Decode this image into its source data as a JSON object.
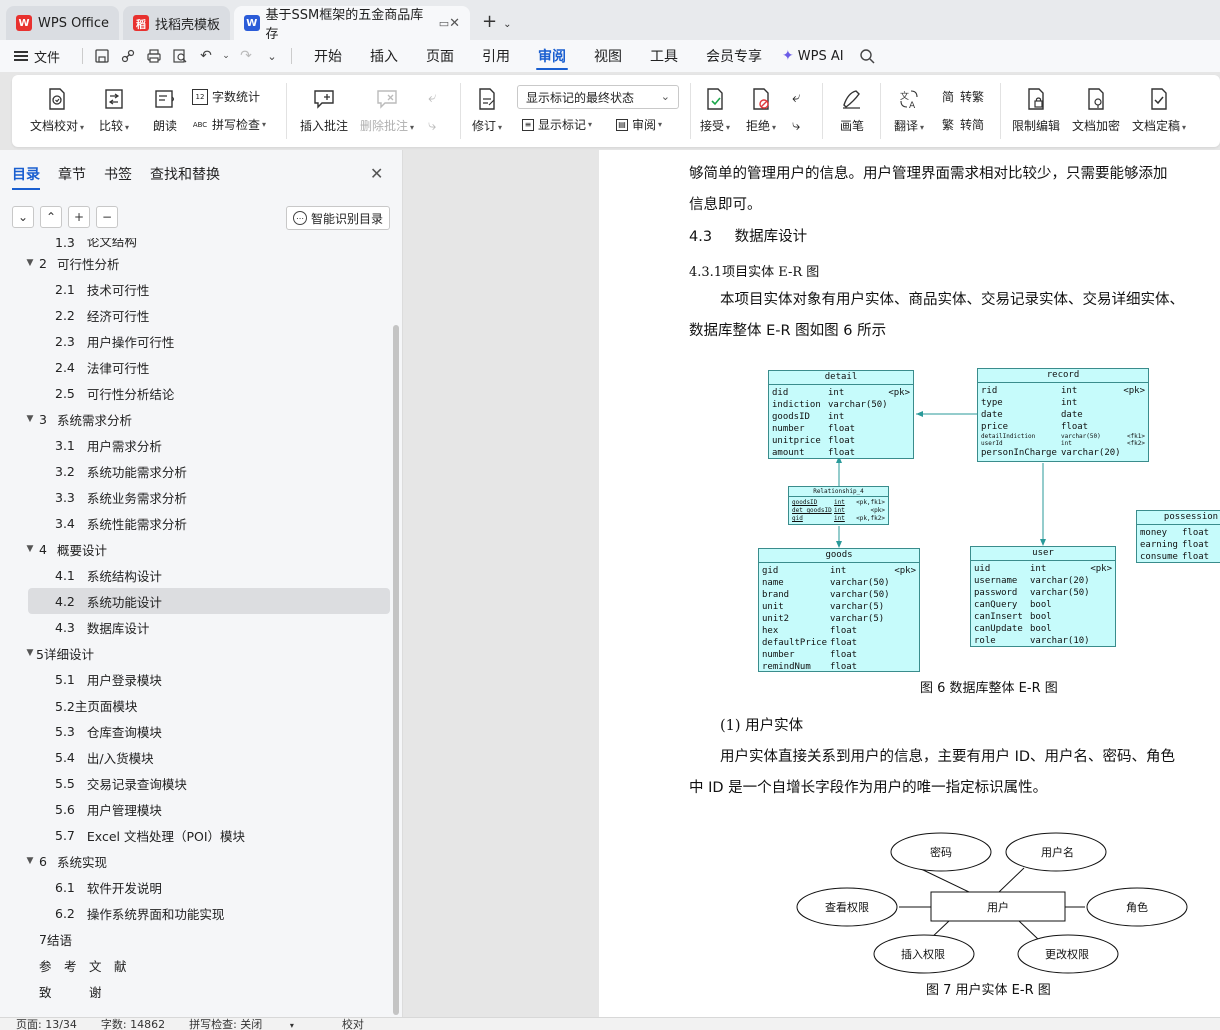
{
  "tabs": [
    {
      "label": "WPS Office",
      "logo": "W",
      "color": "#e8312f"
    },
    {
      "label": "找稻壳模板",
      "logo": "稻",
      "color": "#e8312f"
    },
    {
      "label": "基于SSM框架的五金商品库存",
      "logo": "W",
      "color": "#2b5cd8"
    }
  ],
  "menu": {
    "file": "文件",
    "items": [
      "开始",
      "插入",
      "页面",
      "引用",
      "审阅",
      "视图",
      "工具",
      "会员专享"
    ],
    "ai": "WPS AI"
  },
  "ribbon": {
    "doc_check": "文档校对",
    "compare": "比较",
    "read": "朗读",
    "word_count": "字数统计",
    "spell_check": "拼写检查",
    "insert_comment": "插入批注",
    "delete_comment": "删除批注",
    "track": "修订",
    "show_state": "显示标记的最终状态",
    "show_marks": "显示标记",
    "review": "审阅",
    "accept": "接受",
    "reject": "拒绝",
    "pen": "画笔",
    "translate": "翻译",
    "to_trad": "转繁",
    "to_simp": "转简",
    "restrict": "限制编辑",
    "encrypt": "文档加密",
    "finalize": "文档定稿"
  },
  "nav": {
    "tabs": [
      "目录",
      "章节",
      "书签",
      "查找和替换"
    ],
    "smart_btn": "智能识别目录",
    "toc": [
      {
        "level": 2,
        "num": "1.3",
        "text": "论文结构",
        "partial": true
      },
      {
        "level": 1,
        "num": "2",
        "text": "可行性分析"
      },
      {
        "level": 2,
        "num": "2.1",
        "text": "技术可行性"
      },
      {
        "level": 2,
        "num": "2.2",
        "text": "经济可行性"
      },
      {
        "level": 2,
        "num": "2.3",
        "text": "用户操作可行性"
      },
      {
        "level": 2,
        "num": "2.4",
        "text": "法律可行性"
      },
      {
        "level": 2,
        "num": "2.5",
        "text": "可行性分析结论"
      },
      {
        "level": 1,
        "num": "3",
        "text": "系统需求分析"
      },
      {
        "level": 2,
        "num": "3.1",
        "text": "用户需求分析"
      },
      {
        "level": 2,
        "num": "3.2",
        "text": "系统功能需求分析"
      },
      {
        "level": 2,
        "num": "3.3",
        "text": "系统业务需求分析"
      },
      {
        "level": 2,
        "num": "3.4",
        "text": "系统性能需求分析"
      },
      {
        "level": 1,
        "num": "4",
        "text": "概要设计"
      },
      {
        "level": 2,
        "num": "4.1",
        "text": "系统结构设计"
      },
      {
        "level": 2,
        "num": "4.2",
        "text": "系统功能设计",
        "selected": true
      },
      {
        "level": 2,
        "num": "4.3",
        "text": "数据库设计"
      },
      {
        "level": 1,
        "num": "",
        "text": "5详细设计"
      },
      {
        "level": 2,
        "num": "5.1",
        "text": "用户登录模块"
      },
      {
        "level": 2,
        "num": "",
        "text": "5.2主页面模块"
      },
      {
        "level": 2,
        "num": "5.3",
        "text": "仓库查询模块"
      },
      {
        "level": 2,
        "num": "5.4",
        "text": "出/入货模块"
      },
      {
        "level": 2,
        "num": "5.5",
        "text": "交易记录查询模块"
      },
      {
        "level": 2,
        "num": "5.6",
        "text": "用户管理模块"
      },
      {
        "level": 2,
        "num": "5.7",
        "text": "Excel 文档处理（POI）模块"
      },
      {
        "level": 1,
        "num": "6",
        "text": "系统实现"
      },
      {
        "level": 2,
        "num": "6.1",
        "text": "软件开发说明"
      },
      {
        "level": 2,
        "num": "6.2",
        "text": "操作系统界面和功能实现"
      },
      {
        "level": 0,
        "num": "7",
        "text": "结语"
      },
      {
        "level": 0,
        "num": "",
        "text": "参　考　文　献"
      },
      {
        "level": 0,
        "num": "",
        "text": "致　　　谢"
      }
    ]
  },
  "doc": {
    "p1": "够简单的管理用户的信息。用户管理界面需求相对比较少，只需要能够添加",
    "p2": "信息即可。",
    "h43_num": "4.3",
    "h43": "数据库设计",
    "h431": "4.3.1项目实体 E-R 图",
    "p3": "本项目实体对象有用户实体、商品实体、交易记录实体、交易详细实体、",
    "p4": "数据库整体 E-R 图如图 6 所示",
    "fig6": "图 6  数据库整体 E-R 图",
    "sub1": "(1) 用户实体",
    "p5": "用户实体直接关系到用户的信息，主要有用户 ID、用户名、密码、角色",
    "p6": "中 ID 是一个自增长字段作为用户的唯一指定标识属性。",
    "fig7": "图 7  用户实体  E-R 图"
  },
  "er": {
    "detail": {
      "title": "detail",
      "rows": [
        [
          "did",
          "int",
          "<pk>"
        ],
        [
          "indiction",
          "varchar(50)",
          ""
        ],
        [
          "goodsID",
          "int",
          ""
        ],
        [
          "number",
          "float",
          ""
        ],
        [
          "unitprice",
          "float",
          ""
        ],
        [
          "amount",
          "float",
          ""
        ]
      ]
    },
    "record": {
      "title": "record",
      "rows": [
        [
          "rid",
          "int",
          "<pk>"
        ],
        [
          "type",
          "int",
          ""
        ],
        [
          "date",
          "date",
          ""
        ],
        [
          "price",
          "float",
          ""
        ],
        [
          "personInCharge",
          "varchar(20)",
          ""
        ]
      ],
      "small_rows": [
        [
          "detailIndiction",
          "varchar(50)",
          "<fk1>"
        ],
        [
          "userId",
          "int",
          "<fk2>"
        ]
      ]
    },
    "relationship": {
      "title": "Relationship_4",
      "rows": [
        [
          "goodsID",
          "int",
          "<pk,fk1>"
        ],
        [
          "det_goodsID",
          "int",
          "<pk>"
        ],
        [
          "gid",
          "int",
          "<pk,fk2>"
        ]
      ]
    },
    "goods": {
      "title": "goods",
      "rows": [
        [
          "gid",
          "int",
          "<pk>"
        ],
        [
          "name",
          "varchar(50)",
          ""
        ],
        [
          "brand",
          "varchar(50)",
          ""
        ],
        [
          "unit",
          "varchar(5)",
          ""
        ],
        [
          "unit2",
          "varchar(5)",
          ""
        ],
        [
          "hex",
          "float",
          ""
        ],
        [
          "defaultPrice",
          "float",
          ""
        ],
        [
          "number",
          "float",
          ""
        ],
        [
          "remindNum",
          "float",
          ""
        ]
      ]
    },
    "user": {
      "title": "user",
      "rows": [
        [
          "uid",
          "int",
          "<pk>"
        ],
        [
          "username",
          "varchar(20)",
          ""
        ],
        [
          "password",
          "varchar(50)",
          ""
        ],
        [
          "canQuery",
          "bool",
          ""
        ],
        [
          "canInsert",
          "bool",
          ""
        ],
        [
          "canUpdate",
          "bool",
          ""
        ],
        [
          "role",
          "varchar(10)",
          ""
        ]
      ]
    },
    "possession": {
      "title": "possession",
      "rows": [
        [
          "money",
          "float",
          ""
        ],
        [
          "earning",
          "float",
          ""
        ],
        [
          "consume",
          "float",
          ""
        ]
      ]
    }
  },
  "user_er": {
    "center": "用户",
    "attrs": [
      "密码",
      "用户名",
      "查看权限",
      "角色",
      "插入权限",
      "更改权限"
    ]
  },
  "status": {
    "page": "页面: 13/34",
    "words": "字数: 14862",
    "spell": "拼写检查: 关闭",
    "proof": "校对"
  }
}
